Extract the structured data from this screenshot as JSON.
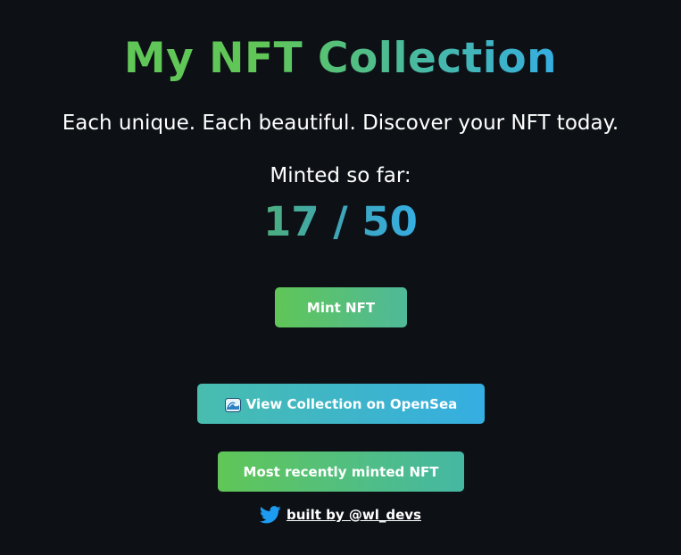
{
  "header": {
    "title": "My NFT Collection",
    "subtitle": "Each unique. Each beautiful. Discover your NFT today."
  },
  "mint_status": {
    "label": "Minted so far:",
    "count_text": "17 / 50"
  },
  "buttons": {
    "mint_label": "Mint NFT",
    "opensea_label": "View Collection on OpenSea",
    "recent_label": "Most recently minted NFT"
  },
  "footer": {
    "link_text": "built by @wl_devs"
  },
  "icons": {
    "opensea_icon": "wave-icon",
    "footer_icon": "twitter-icon"
  },
  "colors": {
    "background": "#0d1116",
    "gradient_green": "#60c657",
    "gradient_blue": "#35aee2",
    "text": "#ffffff"
  }
}
